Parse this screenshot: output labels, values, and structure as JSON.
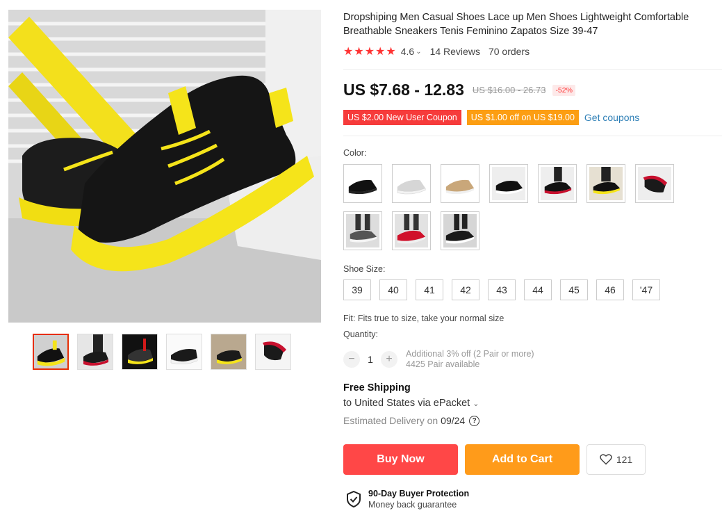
{
  "product": {
    "title": "Dropshiping Men Casual Shoes Lace up Men Shoes Lightweight Comfortable Breathable Sneakers Tenis Feminino Zapatos Size 39-47",
    "stars": "★★★★★",
    "rating": "4.6",
    "reviews": "14 Reviews",
    "orders": "70 orders"
  },
  "price": {
    "current": "US $7.68 - 12.83",
    "original": "US $16.00 - 26.73",
    "discount": "-52%"
  },
  "coupons": {
    "new_user": "US $2.00 New User Coupon",
    "store": "US $1.00 off on US $19.00",
    "get_label": "Get coupons"
  },
  "color": {
    "label": "Color:",
    "options": [
      {
        "name": "black",
        "icon": "shoe-black-icon"
      },
      {
        "name": "white",
        "icon": "shoe-white-icon"
      },
      {
        "name": "khaki",
        "icon": "shoe-khaki-icon"
      },
      {
        "name": "black-white",
        "icon": "shoe-black-white-icon"
      },
      {
        "name": "black-red",
        "icon": "shoe-black-red-icon"
      },
      {
        "name": "black-yellow",
        "icon": "shoe-black-yellow-icon"
      },
      {
        "name": "black-red-2",
        "icon": "shoe-black-red-icon"
      },
      {
        "name": "worn-gray",
        "icon": "shoe-gray-icon"
      },
      {
        "name": "worn-red",
        "icon": "shoe-red-icon"
      },
      {
        "name": "worn-black",
        "icon": "shoe-black-white-icon"
      }
    ]
  },
  "size": {
    "label": "Shoe Size:",
    "options": [
      "39",
      "40",
      "41",
      "42",
      "43",
      "44",
      "45",
      "46",
      "'47"
    ]
  },
  "fit": "Fit: Fits true to size, take your normal size",
  "quantity": {
    "label": "Quantity:",
    "minus": "−",
    "value": "1",
    "plus": "+",
    "offer": "Additional 3% off (2 Pair or more)",
    "available": "4425 Pair available"
  },
  "shipping": {
    "title": "Free Shipping",
    "to": "to United States via ePacket",
    "caret": "⌄",
    "delivery_label": "Estimated Delivery on",
    "delivery_date": "09/24",
    "help": "?"
  },
  "actions": {
    "buy": "Buy Now",
    "cart": "Add to Cart",
    "wishlist_count": "121"
  },
  "protection": {
    "title": "90-Day Buyer Protection",
    "subtitle": "Money back guarantee"
  },
  "colors": {
    "accent_red": "#ff4747",
    "accent_orange": "#ff9b1a",
    "star_red": "#ff3333",
    "link_blue": "#2e7fb6",
    "shoe_yellow": "#f5e41a"
  }
}
